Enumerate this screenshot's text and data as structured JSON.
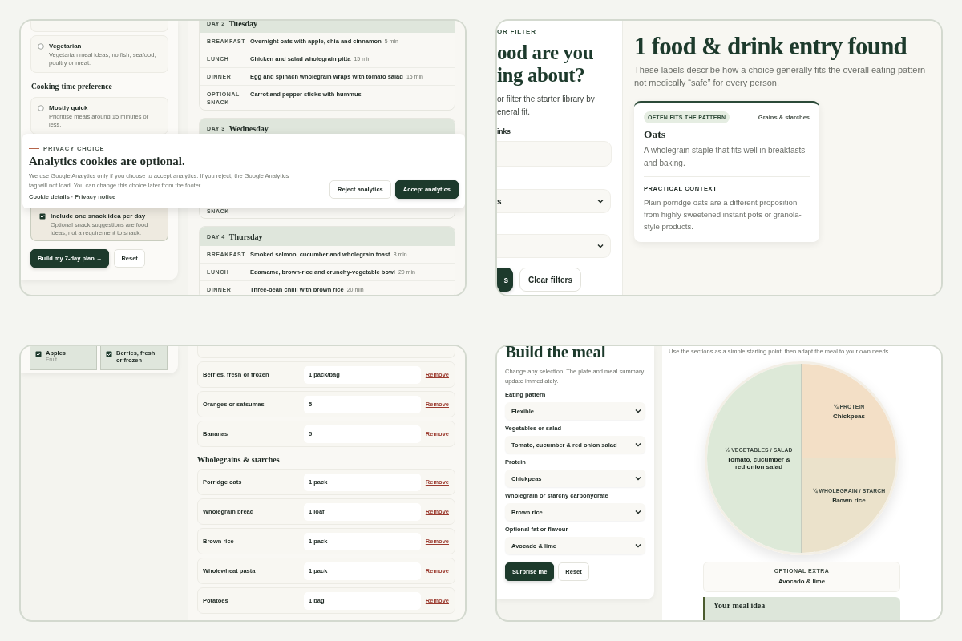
{
  "meal_planner": {
    "sidebar": {
      "diet_options": [
        {
          "title": "Vegetarian",
          "description": "Vegetarian meal ideas; no fish, seafood, poultry or meat.",
          "selected": false
        }
      ],
      "time_heading": "Cooking-time preference",
      "time_options": [
        {
          "title": "Mostly quick",
          "description": "Prioritise meals around 15 minutes or less.",
          "selected": false
        }
      ],
      "snack_option": {
        "label": "Include one snack idea per day",
        "description": "Optional snack suggestions are food ideas, not a requirement to snack.",
        "checked": true
      },
      "buttons": [
        {
          "label": "Build my 7-day plan",
          "kind": "primary",
          "arrow": "→"
        },
        {
          "label": "Reset",
          "kind": "secondary"
        }
      ]
    },
    "days": [
      {
        "day_label": "DAY 2",
        "name": "Tuesday",
        "meals": [
          {
            "slot": "BREAKFAST",
            "dish": "Overnight oats with apple, chia and cinnamon",
            "time": "5 min"
          },
          {
            "slot": "LUNCH",
            "dish": "Chicken and salad wholegrain pitta",
            "time": "15 min"
          },
          {
            "slot": "DINNER",
            "dish": "Egg and spinach wholegrain wraps with tomato salad",
            "time": "15 min"
          },
          {
            "slot": "OPTIONAL SNACK",
            "dish": "Carrot and pepper sticks with hummus"
          }
        ]
      },
      {
        "day_label": "DAY 3",
        "name": "Wednesday",
        "meals": [
          {
            "slot": "SNACK"
          }
        ]
      },
      {
        "day_label": "DAY 4",
        "name": "Thursday",
        "meals": [
          {
            "slot": "BREAKFAST",
            "dish": "Smoked salmon, cucumber and wholegrain toast",
            "time": "8 min"
          },
          {
            "slot": "LUNCH",
            "dish": "Edamame, brown-rice and crunchy-vegetable bowl",
            "time": "20 min"
          },
          {
            "slot": "DINNER",
            "dish": "Three-bean chilli with brown rice",
            "time": "20 min"
          }
        ]
      }
    ],
    "cookie_banner": {
      "kicker": "PRIVACY CHOICE",
      "title": "Analytics cookies are optional.",
      "text": "We use Google Analytics only if you choose to accept analytics. If you reject, the Google Analytics tag will not load. You can change this choice later from the footer.",
      "links": [
        "Cookie details",
        "Privacy notice"
      ],
      "link_separator": "·",
      "buttons": [
        {
          "label": "Reject analytics",
          "kind": "secondary"
        },
        {
          "label": "Accept analytics",
          "kind": "primary"
        }
      ]
    }
  },
  "food_library": {
    "filter": {
      "kicker": "OR FILTER",
      "title_lines": [
        "ood are you",
        "ing about?"
      ],
      "intro_lines": [
        "or filter the starter library by",
        "eneral fit."
      ],
      "field_label": "inks",
      "selects": [
        {
          "kind": "select",
          "value": "s"
        },
        {
          "kind": "select"
        }
      ],
      "buttons": [
        {
          "label": "s",
          "kind": "primary"
        },
        {
          "label": "Clear filters",
          "kind": "secondary"
        }
      ]
    },
    "results": {
      "title": "1 food & drink entry found",
      "note": "These labels describe how a choice generally fits the overall eating pattern — not medically “safe” for every person.",
      "cards": [
        {
          "badge": "OFTEN FITS THE PATTERN",
          "category": "Grains & starches",
          "name": "Oats",
          "summary": "A wholegrain staple that fits well in breakfasts and baking.",
          "context_label": "PRACTICAL CONTEXT",
          "context": "Plain porridge oats are a different proposition from highly sweetened instant pots or granola-style products."
        }
      ]
    }
  },
  "shopping_list": {
    "chips": [
      {
        "name": "Apples",
        "group": "Fruit",
        "checked": true
      },
      {
        "name": "Berries, fresh or frozen",
        "checked": true
      }
    ],
    "groups": [
      {
        "items": [
          {
            "name": "Berries, fresh or frozen",
            "quantity": "1 pack/bag",
            "action": "Remove"
          },
          {
            "name": "Oranges or satsumas",
            "quantity": "5",
            "action": "Remove"
          },
          {
            "name": "Bananas",
            "quantity": "5",
            "action": "Remove"
          }
        ]
      },
      {
        "heading": "Wholegrains & starches",
        "items": [
          {
            "name": "Porridge oats",
            "quantity": "1 pack",
            "action": "Remove"
          },
          {
            "name": "Wholegrain bread",
            "quantity": "1 loaf",
            "action": "Remove"
          },
          {
            "name": "Brown rice",
            "quantity": "1 pack",
            "action": "Remove"
          },
          {
            "name": "Wholewheat pasta",
            "quantity": "1 pack",
            "action": "Remove"
          },
          {
            "name": "Potatoes",
            "quantity": "1 bag",
            "action": "Remove"
          }
        ]
      }
    ]
  },
  "meal_builder": {
    "title": "Build the meal",
    "intro": "Change any selection. The plate and meal summary update immediately.",
    "fields": [
      {
        "label": "Eating pattern",
        "value": "Flexible"
      },
      {
        "label": "Vegetables or salad",
        "value": "Tomato, cucumber & red onion salad"
      },
      {
        "label": "Protein",
        "value": "Chickpeas"
      },
      {
        "label": "Wholegrain or starchy carbohydrate",
        "value": "Brown rice"
      },
      {
        "label": "Optional fat or flavour",
        "value": "Avocado & lime"
      }
    ],
    "buttons": [
      {
        "label": "Surprise me",
        "kind": "primary"
      },
      {
        "label": "Reset",
        "kind": "secondary"
      }
    ],
    "caption": "Use the sections as a simple starting point, then adapt the meal to your own needs.",
    "plate": {
      "sections": [
        {
          "portion": "½ VEGETABLES / SALAD",
          "food": "Tomato, cucumber & red onion salad",
          "color": "#dde9d8"
        },
        {
          "portion": "¼ PROTEIN",
          "food": "Chickpeas",
          "color": "#f3dfc6"
        },
        {
          "portion": "¼ WHOLEGRAIN / STARCH",
          "food": "Brown rice",
          "color": "#ebe2cb"
        }
      ]
    },
    "extra": {
      "label": "OPTIONAL EXTRA",
      "value": "Avocado & lime"
    },
    "summary_title": "Your meal idea"
  }
}
